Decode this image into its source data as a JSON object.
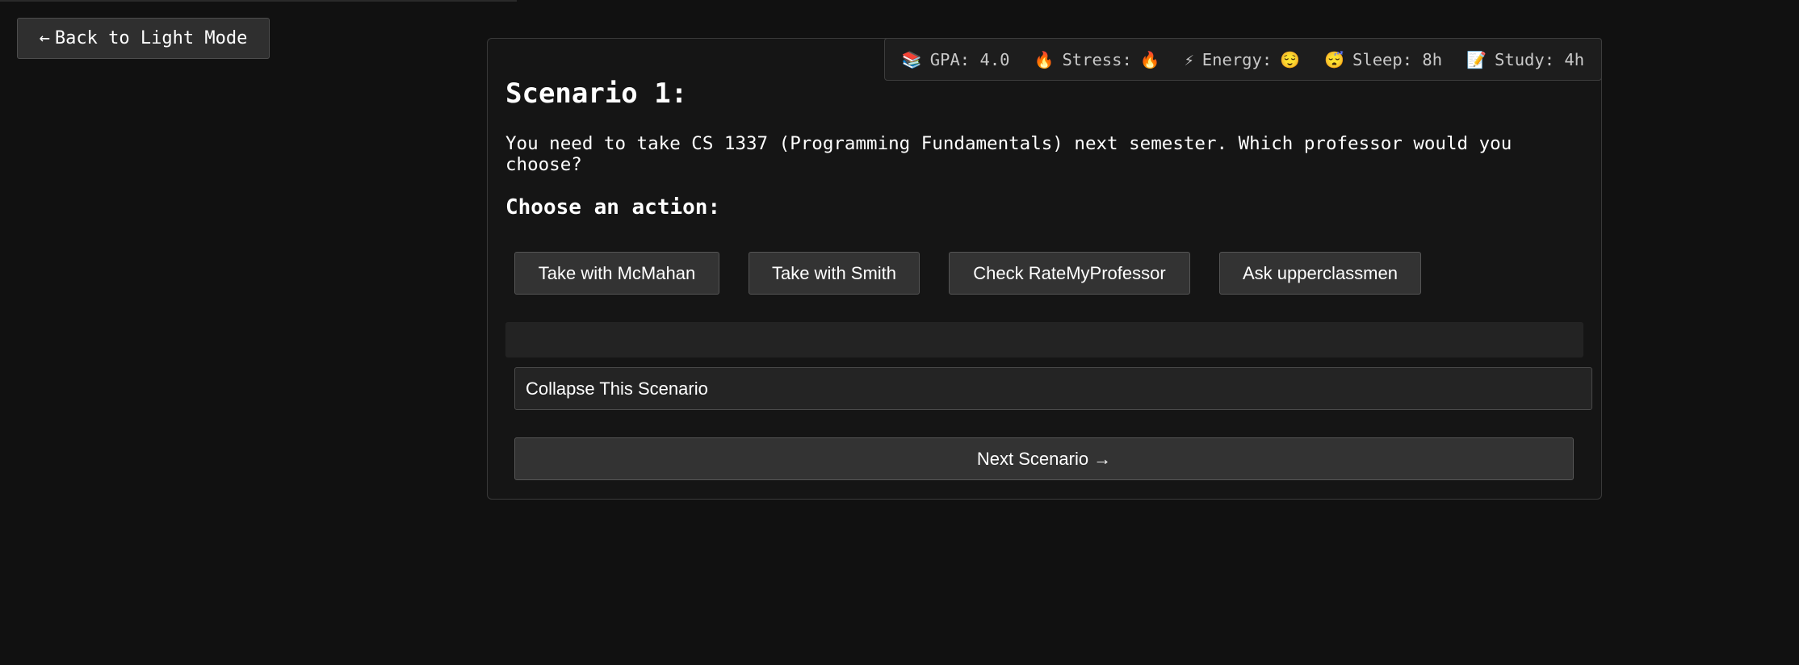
{
  "back_button": {
    "arrow": "←",
    "label": "Back to Light Mode"
  },
  "stats": [
    {
      "icon": "📚",
      "icon_name": "books-icon",
      "label": "GPA: 4.0",
      "suffix": ""
    },
    {
      "icon": "🔥",
      "icon_name": "fire-icon",
      "label": "Stress:",
      "suffix": "🔥"
    },
    {
      "icon": "⚡",
      "icon_name": "lightning-icon",
      "label": "Energy:",
      "suffix": "😌"
    },
    {
      "icon": "😴",
      "icon_name": "sleeping-face-icon",
      "label": "Sleep: 8h",
      "suffix": ""
    },
    {
      "icon": "📝",
      "icon_name": "memo-icon",
      "label": "Study: 4h",
      "suffix": ""
    }
  ],
  "scenario": {
    "title": "Scenario 1:",
    "text": "You need to take CS 1337 (Programming Fundamentals) next semester. Which professor would you choose?",
    "choose_label": "Choose an action:"
  },
  "actions": [
    "Take with McMahan",
    "Take with Smith",
    "Check RateMyProfessor",
    "Ask upperclassmen"
  ],
  "collapse_label": "Collapse This Scenario",
  "next_button": {
    "label": "Next Scenario",
    "arrow": "→"
  },
  "colors": {
    "background": "#111111",
    "panel": "#151515",
    "button": "#333333",
    "text": "#ffffff"
  }
}
